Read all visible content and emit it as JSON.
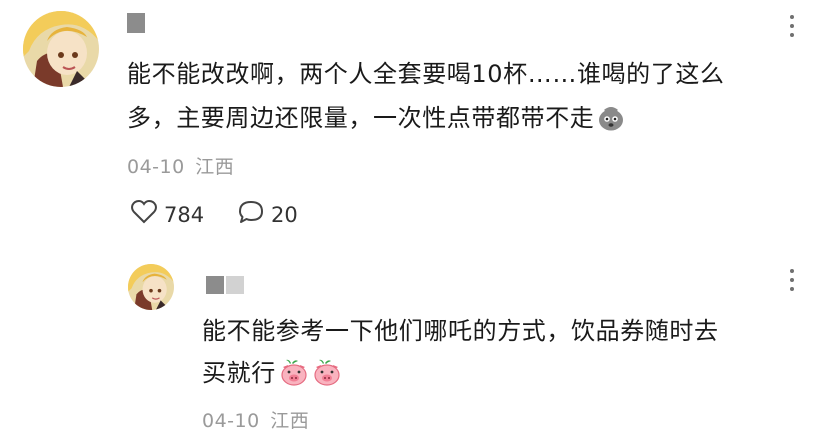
{
  "comment": {
    "author": "",
    "text_line1": "能不能改改啊，两个人全套要喝10杯……谁喝的了这么",
    "text_line2": "多，主要周边还限量，一次性点带都带不走",
    "emoji_icon": "sad-face-icon",
    "date": "04-10",
    "location": "江西",
    "likes": "784",
    "comments": "20"
  },
  "reply": {
    "author": "",
    "text_line1": "能不能参考一下他们哪吒的方式，饮品券随时去",
    "text_line2": "买就行",
    "emoji_icons": [
      "pig-face-icon",
      "pig-face-icon"
    ],
    "date": "04-10",
    "location": "江西"
  },
  "colors": {
    "text": "#1a1a1a",
    "meta": "#9a9a9a",
    "redact_dark": "#8c8c8c",
    "redact_light": "#d2d2d2"
  }
}
